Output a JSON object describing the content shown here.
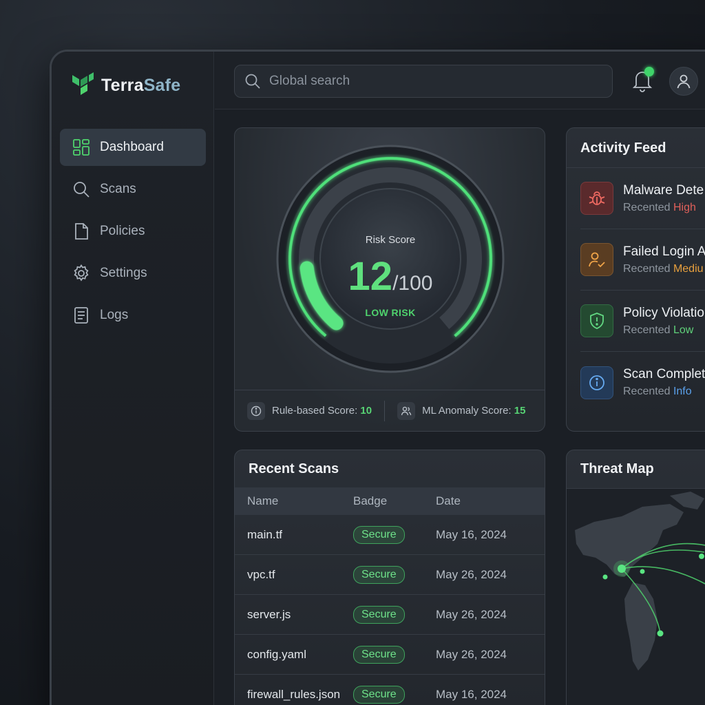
{
  "app": {
    "brand_part1": "Terra",
    "brand_part2": "Safe"
  },
  "sidebar": {
    "items": [
      {
        "label": "Dashboard",
        "icon": "dashboard-icon",
        "active": true
      },
      {
        "label": "Scans",
        "icon": "search-icon"
      },
      {
        "label": "Policies",
        "icon": "document-icon"
      },
      {
        "label": "Settings",
        "icon": "gear-icon"
      },
      {
        "label": "Logs",
        "icon": "log-icon"
      }
    ]
  },
  "topbar": {
    "search_placeholder": "Global search"
  },
  "risk": {
    "label": "Risk Score",
    "score": "12",
    "max": "/100",
    "level": "LOW RISK",
    "score_fraction": 0.12,
    "rule_label": "Rule-based Score:",
    "rule_value": "10",
    "ml_label": "ML Anomaly Score:",
    "ml_value": "15"
  },
  "feed": {
    "title": "Activity Feed",
    "items": [
      {
        "title": "Malware Dete",
        "prefix": "Recented",
        "severity": "High",
        "severity_color": "#e0605a",
        "icon": "bug-icon"
      },
      {
        "title": "Failed Login A",
        "prefix": "Recented",
        "severity": "Mediu",
        "severity_color": "#e8a03e",
        "icon": "user-check-icon"
      },
      {
        "title": "Policy Violatio",
        "prefix": "Recented",
        "severity": "Low",
        "severity_color": "#5fd17a",
        "icon": "shield-icon"
      },
      {
        "title": "Scan Complet",
        "prefix": "Recented",
        "severity": "Info",
        "severity_color": "#5aa0ea",
        "icon": "info-icon"
      }
    ]
  },
  "scans": {
    "title": "Recent Scans",
    "columns": [
      "Name",
      "Badge",
      "Date"
    ],
    "rows": [
      {
        "name": "main.tf",
        "badge": "Secure",
        "date": "May 16, 2024"
      },
      {
        "name": "vpc.tf",
        "badge": "Secure",
        "date": "May 26, 2024"
      },
      {
        "name": "server.js",
        "badge": "Secure",
        "date": "May 26, 2024"
      },
      {
        "name": "config.yaml",
        "badge": "Secure",
        "date": "May 26, 2024"
      },
      {
        "name": "firewall_rules.json",
        "badge": "Secure",
        "date": "May 16, 2024"
      }
    ]
  },
  "map": {
    "title": "Threat Map"
  },
  "colors": {
    "accent": "#4fd36d",
    "background": "#1b1f25"
  }
}
